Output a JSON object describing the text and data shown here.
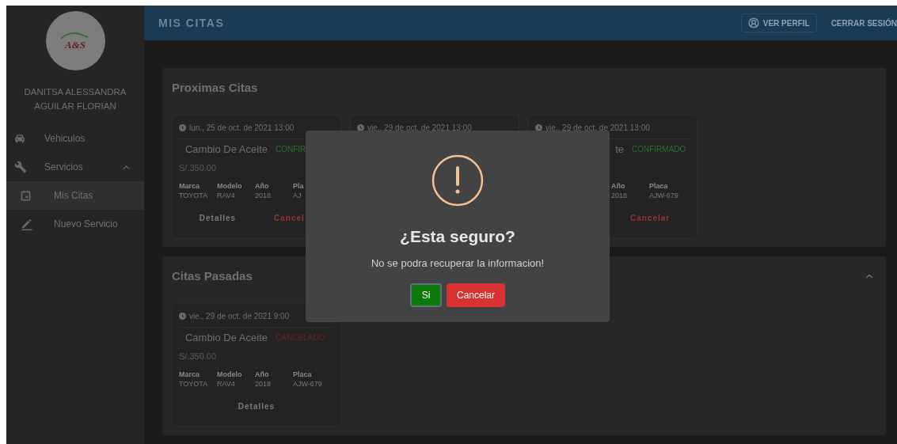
{
  "header": {
    "title": "MIS CITAS",
    "actions": [
      {
        "label": "VER PERFIL",
        "kind": "outlined"
      },
      {
        "label": "CERRAR SESIÓN",
        "kind": "text"
      }
    ]
  },
  "sidebar": {
    "user_name": "DANITSA ALESSANDRA AGUILAR FLORIAN",
    "logo_text": "A&S",
    "items": [
      {
        "label": "Vehiculos"
      },
      {
        "label": "Servicios",
        "expanded": true,
        "children": [
          {
            "label": "Mis Citas",
            "selected": true
          },
          {
            "label": "Nuevo Servicio",
            "selected": false
          }
        ]
      }
    ]
  },
  "sections": [
    {
      "title": "Proximas Citas",
      "cards": [
        {
          "date": "lun., 25 de oct. de 2021 13:00",
          "title": "Cambio De Aceite",
          "status": {
            "text": "CONFIR",
            "kind": "confirmed"
          },
          "price": "S/.350.00",
          "specs": [
            {
              "label": "Marca",
              "value": "TOYOTA"
            },
            {
              "label": "Modelo",
              "value": "RAV4"
            },
            {
              "label": "Año",
              "value": "2018"
            },
            {
              "label": "Pla",
              "value": "AJ"
            }
          ],
          "actions": [
            {
              "label": "Detalles",
              "kind": "details"
            },
            {
              "label": "Cancel",
              "kind": "cancel"
            }
          ]
        },
        {
          "date": "vie., 29 de oct. de 2021 13:00"
        },
        {
          "date": "vie., 29 de oct. de 2021 13:00",
          "title": "te",
          "status": {
            "text": "CONFIRMADO",
            "kind": "confirmed"
          },
          "specs": [
            {
              "label": "Año",
              "value": "2018"
            },
            {
              "label": "Placa",
              "value": "AJW-679"
            }
          ],
          "actions": [
            {
              "label": "Cancelar",
              "kind": "cancel"
            }
          ]
        }
      ]
    },
    {
      "title": "Citas Pasadas",
      "expanded": true,
      "cards": [
        {
          "date": "vie., 29 de oct. de 2021 9:00",
          "title": "Cambio De Aceite",
          "status": {
            "text": "CANCELADO",
            "kind": "cancelled"
          },
          "price": "S/.350.00",
          "specs": [
            {
              "label": "Marca",
              "value": "TOYOTA"
            },
            {
              "label": "Modelo",
              "value": "RAV4"
            },
            {
              "label": "Año",
              "value": "2018"
            },
            {
              "label": "Placa",
              "value": "AJW-679"
            }
          ],
          "actions": [
            {
              "label": "Detalles",
              "kind": "details"
            }
          ]
        }
      ]
    }
  ],
  "dialog": {
    "title": "¿Esta seguro?",
    "message": "No se podra recuperar la informacion!",
    "buttons": [
      {
        "label": "Si",
        "kind": "confirm"
      },
      {
        "label": "Cancelar",
        "kind": "cancel"
      }
    ]
  }
}
